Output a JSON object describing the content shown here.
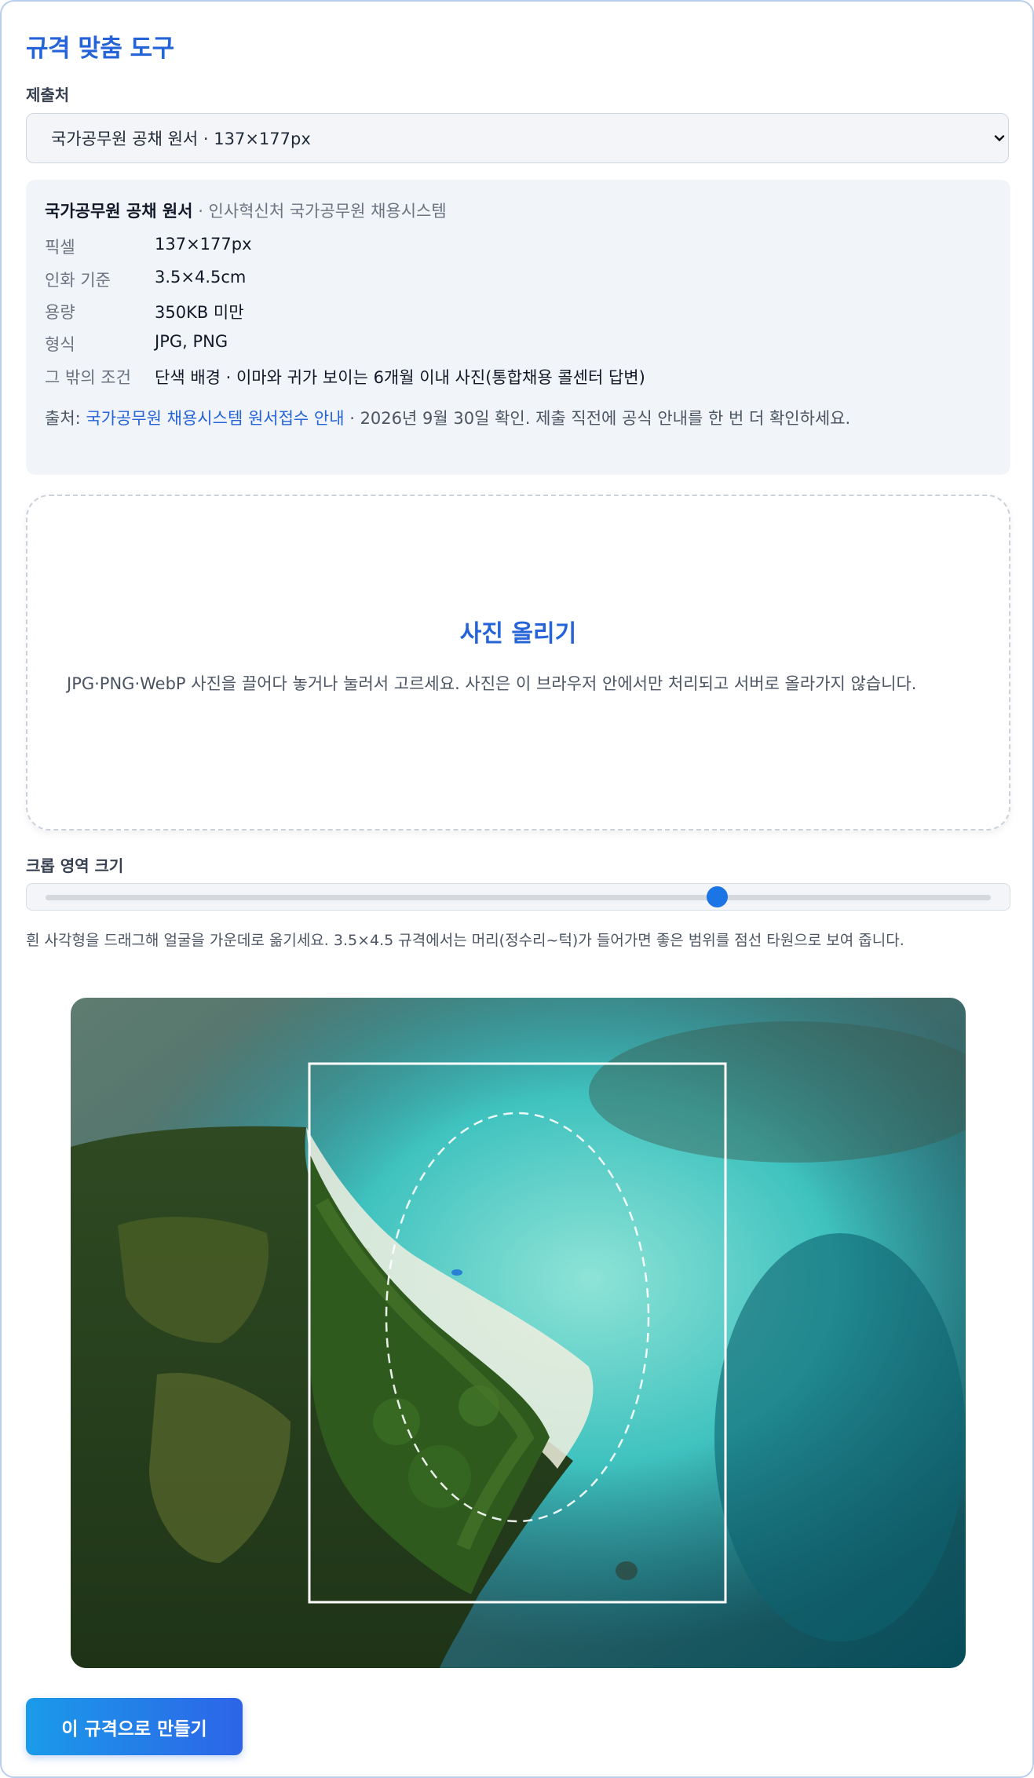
{
  "title": "규격 맞춤 도구",
  "submission": {
    "label": "제출처",
    "selected": "국가공무원 공채 원서 · 137×177px"
  },
  "spec": {
    "name": "국가공무원 공채 원서",
    "agency": " · 인사혁신처 국가공무원 채용시스템",
    "rows": [
      {
        "key": "픽셀",
        "value": "137×177px"
      },
      {
        "key": "인화 기준",
        "value": "3.5×4.5cm"
      },
      {
        "key": "용량",
        "value": "350KB 미만"
      },
      {
        "key": "형식",
        "value": "JPG, PNG"
      },
      {
        "key": "그 밖의 조건",
        "value": "단색 배경 · 이마와 귀가 보이는 6개월 이내 사진(통합채용 콜센터 답변)"
      }
    ],
    "source_prefix": "출처: ",
    "source_link": "국가공무원 채용시스템 원서접수 안내",
    "source_suffix": " · 2026년 9월 30일 확인. 제출 직전에 공식 안내를 한 번 더 확인하세요."
  },
  "upload": {
    "heading": "사진 올리기",
    "description": "JPG·PNG·WebP 사진을 끌어다 놓거나 눌러서 고르세요. 사진은 이 브라우저 안에서만 처리되고 서버로 올라가지 않습니다."
  },
  "crop": {
    "label": "크롭 영역 크기",
    "slider_value": 0.71,
    "hint": "흰 사각형을 드래그해 얼굴을 가운데로 옮기세요. 3.5×4.5 규격에서는 머리(정수리~턱)가 들어가면 좋은 범위를 점선 타원으로 보여 줍니다."
  },
  "action": {
    "generate_label": "이 규격으로 만들기"
  },
  "colors": {
    "accent": "#2563d9",
    "button_start": "#1a9be9",
    "button_end": "#2d64e8",
    "slider_thumb": "#1c75e4"
  }
}
